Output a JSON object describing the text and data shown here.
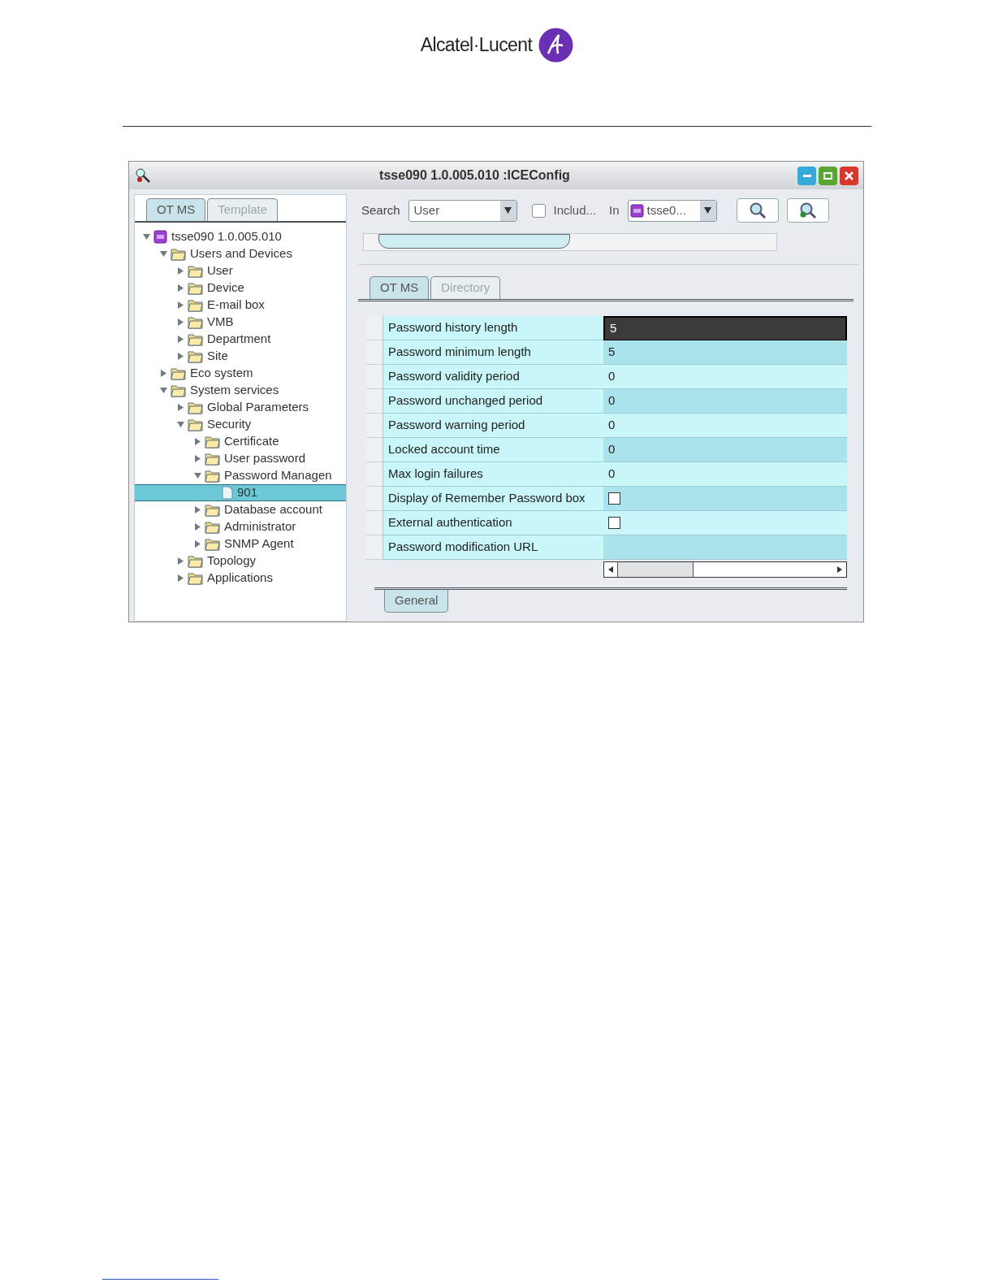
{
  "header": {
    "logo_text": "Alcatel·Lucent"
  },
  "window": {
    "title": "tsse090 1.0.005.010 :ICEConfig"
  },
  "left_tabs": [
    {
      "label": "OT MS",
      "selected": true
    },
    {
      "label": "Template",
      "selected": false
    }
  ],
  "tree": [
    {
      "label": "tsse090 1.0.005.010",
      "kind": "server",
      "expanded": true,
      "selected": false,
      "children": [
        {
          "label": "Users and Devices",
          "kind": "folder",
          "expanded": true,
          "selected": false,
          "children": [
            {
              "label": "User",
              "kind": "folder",
              "expanded": false,
              "selected": false
            },
            {
              "label": "Device",
              "kind": "folder",
              "expanded": false,
              "selected": false
            },
            {
              "label": "E-mail box",
              "kind": "folder",
              "expanded": false,
              "selected": false
            },
            {
              "label": "VMB",
              "kind": "folder",
              "expanded": false,
              "selected": false
            },
            {
              "label": "Department",
              "kind": "folder",
              "expanded": false,
              "selected": false
            },
            {
              "label": "Site",
              "kind": "folder",
              "expanded": false,
              "selected": false
            }
          ]
        },
        {
          "label": "Eco system",
          "kind": "folder",
          "expanded": false,
          "selected": false
        },
        {
          "label": "System services",
          "kind": "folder",
          "expanded": true,
          "selected": false,
          "children": [
            {
              "label": "Global Parameters",
              "kind": "folder",
              "expanded": false,
              "selected": false
            },
            {
              "label": "Security",
              "kind": "folder",
              "expanded": true,
              "selected": false,
              "children": [
                {
                  "label": "Certificate",
                  "kind": "folder",
                  "expanded": false,
                  "selected": false
                },
                {
                  "label": "User password",
                  "kind": "folder",
                  "expanded": false,
                  "selected": false
                },
                {
                  "label": "Password Managen",
                  "kind": "folder",
                  "expanded": true,
                  "selected": false,
                  "children": [
                    {
                      "label": "901",
                      "kind": "leaf",
                      "selected": true
                    }
                  ]
                },
                {
                  "label": "Database account",
                  "kind": "folder",
                  "expanded": false,
                  "selected": false
                },
                {
                  "label": "Administrator",
                  "kind": "folder",
                  "expanded": false,
                  "selected": false
                },
                {
                  "label": "SNMP Agent",
                  "kind": "folder",
                  "expanded": false,
                  "selected": false
                }
              ]
            },
            {
              "label": "Topology",
              "kind": "folder",
              "expanded": false,
              "selected": false
            },
            {
              "label": "Applications",
              "kind": "folder",
              "expanded": false,
              "selected": false
            }
          ]
        }
      ]
    }
  ],
  "search": {
    "label": "Search",
    "value": "User",
    "include_label": "Includ...",
    "include_checked": false,
    "in_label": "In",
    "in_value": "tsse0..."
  },
  "right_tabs": [
    {
      "label": "OT MS",
      "selected": true
    },
    {
      "label": "Directory",
      "selected": false
    }
  ],
  "properties": [
    {
      "name": "Password history length",
      "kind": "text",
      "value": "5",
      "selected": true
    },
    {
      "name": "Password minimum length",
      "kind": "text",
      "value": "5",
      "selected": false
    },
    {
      "name": "Password validity period",
      "kind": "text",
      "value": "0",
      "selected": false
    },
    {
      "name": "Password unchanged period",
      "kind": "text",
      "value": "0",
      "selected": false
    },
    {
      "name": "Password warning period",
      "kind": "text",
      "value": "0",
      "selected": false
    },
    {
      "name": "Locked account time",
      "kind": "text",
      "value": "0",
      "selected": false
    },
    {
      "name": "Max login failures",
      "kind": "text",
      "value": "0",
      "selected": false
    },
    {
      "name": "Display of Remember Password box",
      "kind": "checkbox",
      "checked": false,
      "selected": false
    },
    {
      "name": "External authentication",
      "kind": "checkbox",
      "checked": false,
      "selected": false
    },
    {
      "name": "Password modification URL",
      "kind": "text",
      "selected": false
    }
  ],
  "bottom_tabs": [
    {
      "label": "General",
      "selected": true
    }
  ]
}
